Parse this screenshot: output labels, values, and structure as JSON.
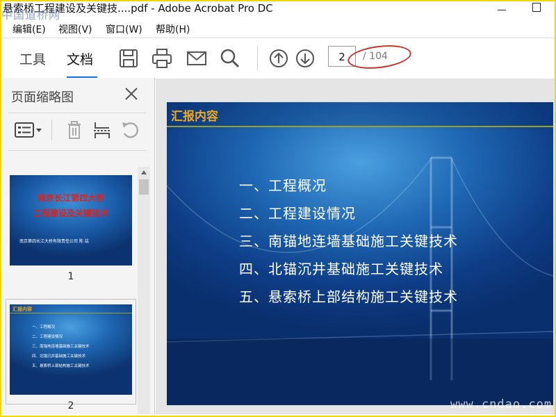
{
  "window": {
    "title": "悬索桥工程建设及关键技....pdf - Adobe Acrobat Pro DC",
    "watermark_top": "中国道桥网"
  },
  "menu": [
    "编辑(E)",
    "视图(V)",
    "窗口(W)",
    "帮助(H)"
  ],
  "toolbar": {
    "tabs": [
      "工具",
      "文档"
    ],
    "active_tab": "文档",
    "icons": [
      "save-icon",
      "print-icon",
      "email-icon",
      "search-icon",
      "page-up-icon",
      "page-down-icon"
    ],
    "current_page": "2",
    "total_pages": "/ 104",
    "annotation_color": "#c8332b"
  },
  "sidepanel": {
    "title": "页面缩略图",
    "thumbnails": [
      {
        "number": "1",
        "title_line1": "南京长江第四大桥",
        "title_line2": "工程建设及关键技术",
        "subtitle": "南京第四长江大桥有限责任公司 陈 竑"
      },
      {
        "number": "2",
        "heading": "汇报内容",
        "items": [
          "一、工程概况",
          "二、工程建设情况",
          "三、南锚地连墙基础施工关键技术",
          "四、北锚沉井基础施工关键技术",
          "五、悬索桥上部结构施工关键技术"
        ]
      }
    ]
  },
  "slide": {
    "heading": "汇报内容",
    "items": [
      "一、工程概况",
      "二、工程建设情况",
      "三、南锚地连墙基础施工关键技术",
      "四、北锚沉井基础施工关键技术",
      "五、悬索桥上部结构施工关键技术"
    ],
    "heading_color": "#f2a81d"
  },
  "watermark_bottom": "www.cndao.com"
}
